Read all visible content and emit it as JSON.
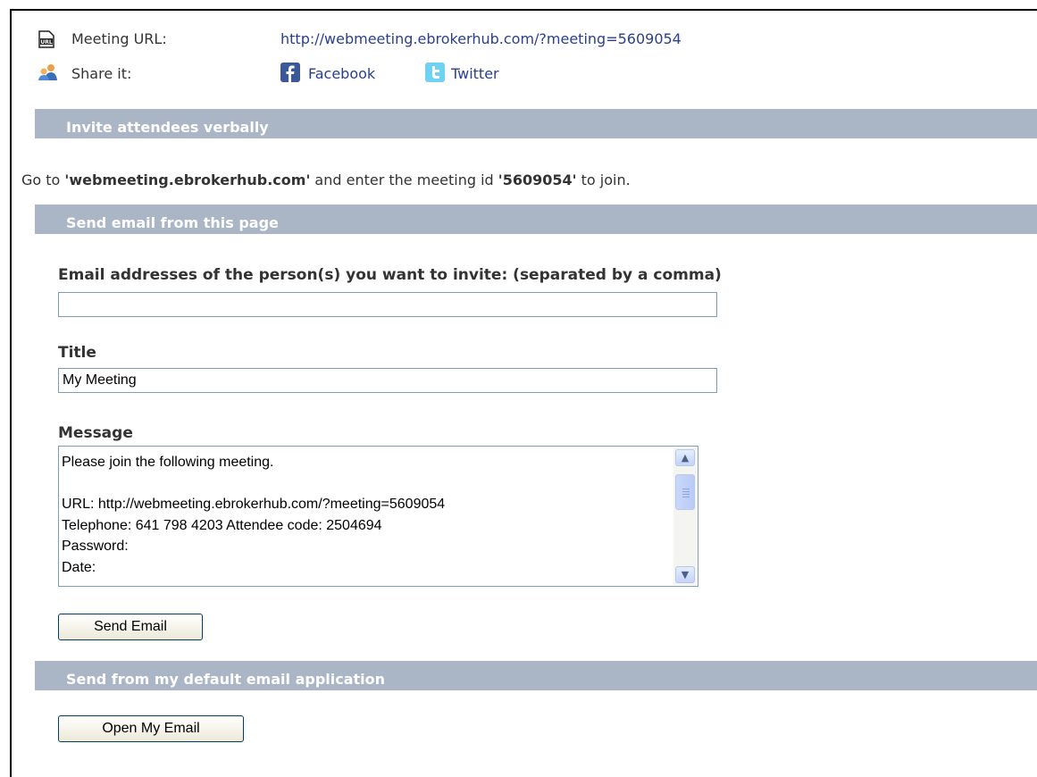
{
  "meeting": {
    "url_label": "Meeting URL:",
    "url": "http://webmeeting.ebrokerhub.com/?meeting=5609054",
    "share_label": "Share it:",
    "facebook": "Facebook",
    "twitter": "Twitter"
  },
  "verbal": {
    "header": "Invite attendees verbally",
    "text_1": "Go to ",
    "site": "'webmeeting.ebrokerhub.com'",
    "text_2": " and enter the meeting id ",
    "meeting_id": "'5609054'",
    "text_3": " to join."
  },
  "email_page": {
    "header": "Send email from this page",
    "emails_label": "Email addresses of the person(s) you want to invite: (separated by a comma)",
    "emails_value": "",
    "title_label": "Title",
    "title_value": "My Meeting",
    "message_label": "Message",
    "message_value": "Please join the following meeting.\n\nURL: http://webmeeting.ebrokerhub.com/?meeting=5609054\nTelephone: 641 798 4203 Attendee code: 2504694\nPassword:\nDate:",
    "send_button": "Send Email"
  },
  "default_app": {
    "header": "Send from my default email application",
    "open_button": "Open My Email"
  },
  "icons": {
    "url": "url-icon",
    "share": "share-people-icon",
    "facebook": "facebook-icon",
    "twitter": "twitter-icon",
    "scroll_up": "scroll-up-icon",
    "scroll_down": "scroll-down-icon"
  },
  "colors": {
    "section_bar": "#aab5c5",
    "link": "#2a3f8f",
    "facebook": "#3b5998",
    "twitter": "#33ccff"
  }
}
